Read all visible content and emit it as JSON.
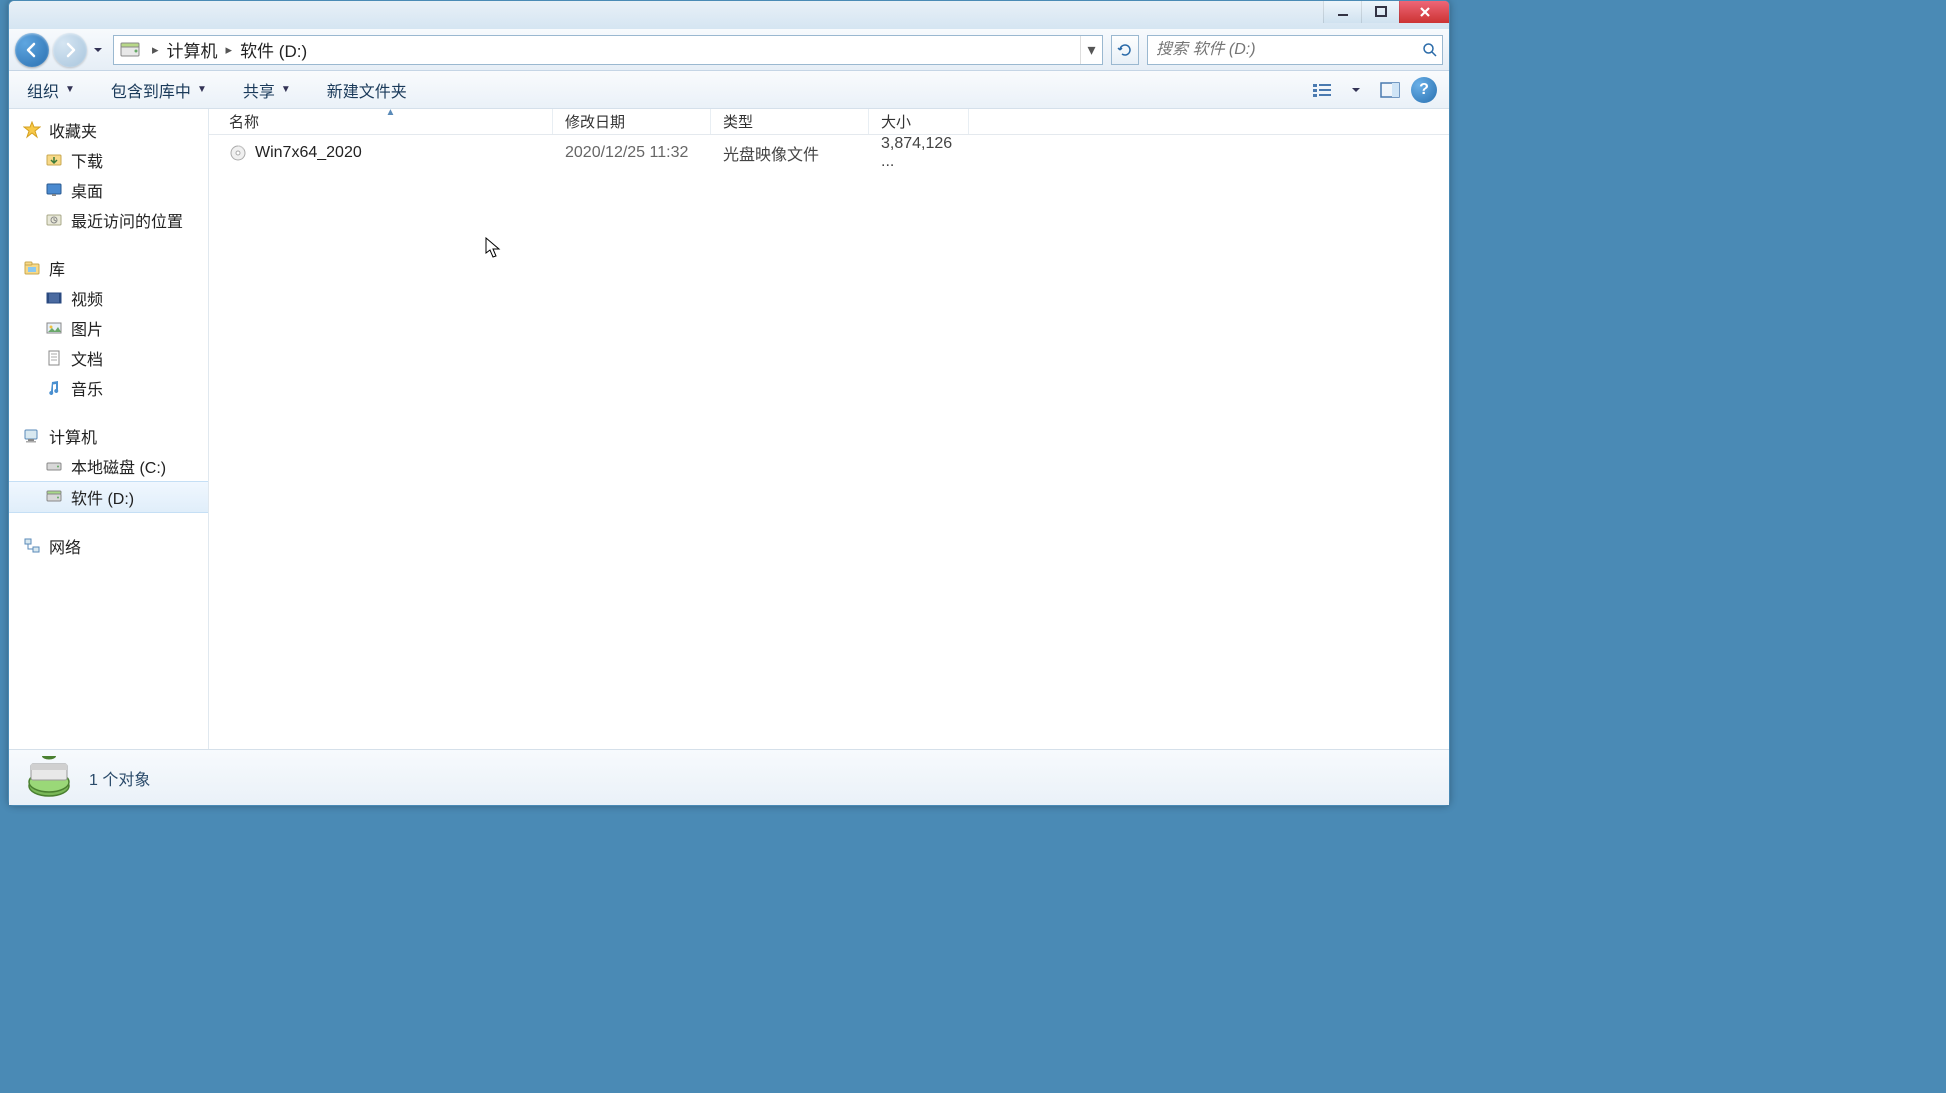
{
  "breadcrumb": {
    "seg1": "计算机",
    "seg2": "软件 (D:)"
  },
  "search": {
    "placeholder": "搜索 软件 (D:)"
  },
  "toolbar": {
    "organize": "组织",
    "include": "包含到库中",
    "share": "共享",
    "newfolder": "新建文件夹"
  },
  "columns": {
    "name": "名称",
    "date": "修改日期",
    "type": "类型",
    "size": "大小"
  },
  "sidebar": {
    "favorites": {
      "label": "收藏夹",
      "items": [
        "下载",
        "桌面",
        "最近访问的位置"
      ]
    },
    "library": {
      "label": "库",
      "items": [
        "视频",
        "图片",
        "文档",
        "音乐"
      ]
    },
    "computer": {
      "label": "计算机",
      "items": [
        "本地磁盘 (C:)",
        "软件 (D:)"
      ]
    },
    "network": {
      "label": "网络"
    }
  },
  "files": [
    {
      "name": "Win7x64_2020",
      "date": "2020/12/25 11:32",
      "type": "光盘映像文件",
      "size": "3,874,126 ..."
    }
  ],
  "status": {
    "text": "1 个对象"
  }
}
